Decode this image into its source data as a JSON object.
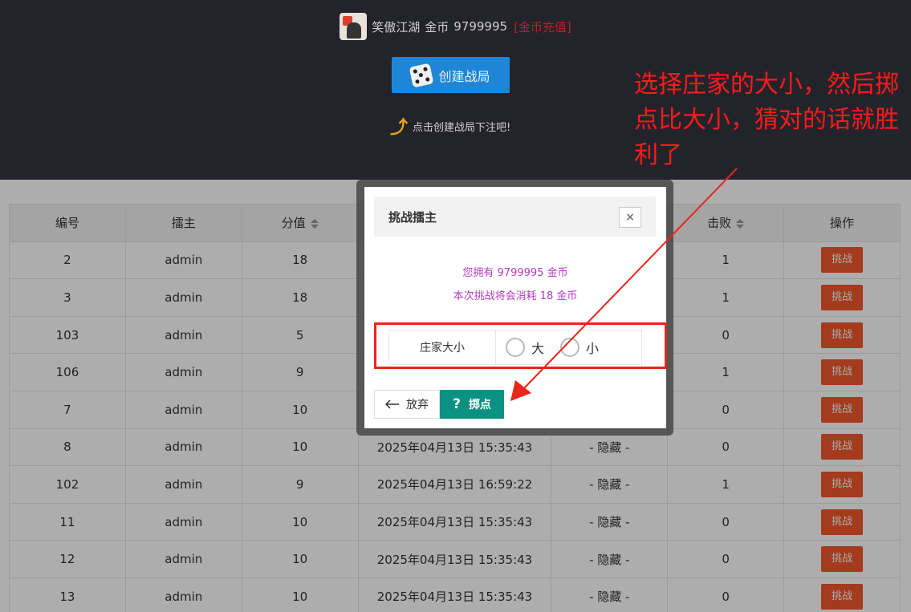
{
  "header": {
    "username": "笑傲江湖",
    "coin_label": "金币",
    "coin_amount": "9799995",
    "recharge_link": "[金币充值]",
    "create_button": "创建战局",
    "hint": "点击创建战局下注吧!"
  },
  "table": {
    "columns": [
      "编号",
      "擂主",
      "分值",
      "",
      "",
      "击败",
      "操作"
    ],
    "rows": [
      {
        "id": "2",
        "host": "admin",
        "score": "18",
        "time": "",
        "bet": "",
        "wins": "1",
        "action": "挑战"
      },
      {
        "id": "3",
        "host": "admin",
        "score": "18",
        "time": "",
        "bet": "",
        "wins": "1",
        "action": "挑战"
      },
      {
        "id": "103",
        "host": "admin",
        "score": "5",
        "time": "",
        "bet": "",
        "wins": "0",
        "action": "挑战"
      },
      {
        "id": "106",
        "host": "admin",
        "score": "9",
        "time": "",
        "bet": "",
        "wins": "1",
        "action": "挑战"
      },
      {
        "id": "7",
        "host": "admin",
        "score": "10",
        "time": "",
        "bet": "",
        "wins": "0",
        "action": "挑战"
      },
      {
        "id": "8",
        "host": "admin",
        "score": "10",
        "time": "2025年04月13日 15:35:43",
        "bet": "- 隐藏 -",
        "wins": "0",
        "action": "挑战"
      },
      {
        "id": "102",
        "host": "admin",
        "score": "9",
        "time": "2025年04月13日 16:59:22",
        "bet": "- 隐藏 -",
        "wins": "1",
        "action": "挑战"
      },
      {
        "id": "11",
        "host": "admin",
        "score": "10",
        "time": "2025年04月13日 15:35:43",
        "bet": "- 隐藏 -",
        "wins": "0",
        "action": "挑战"
      },
      {
        "id": "12",
        "host": "admin",
        "score": "10",
        "time": "2025年04月13日 15:35:43",
        "bet": "- 隐藏 -",
        "wins": "0",
        "action": "挑战"
      },
      {
        "id": "13",
        "host": "admin",
        "score": "10",
        "time": "2025年04月13日 15:35:43",
        "bet": "- 隐藏 -",
        "wins": "0",
        "action": "挑战"
      }
    ]
  },
  "modal": {
    "title": "挑战擂主",
    "close": "×",
    "owned_line": "您拥有 9799995 金币",
    "cost_line": "本次挑战将会消耗 18 金币",
    "choice_label": "庄家大小",
    "option_big": "大",
    "option_small": "小",
    "giveup_button": "放弃",
    "roll_button": "掷点"
  },
  "annotation": {
    "text": "选择庄家的大小，然后掷点比大小，猜对的话就胜利了"
  },
  "colors": {
    "header_bg": "#23232b",
    "primary_blue": "#1e86d6",
    "challenge_orange": "#f0582a",
    "roll_teal": "#0b9182",
    "info_purple": "#b23dbf",
    "annotation_red": "#e8261c"
  }
}
